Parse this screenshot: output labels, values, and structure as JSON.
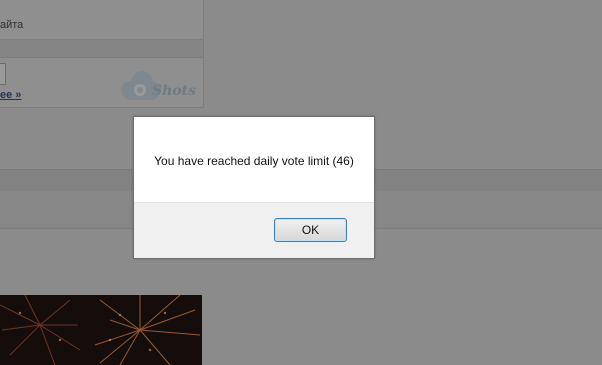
{
  "background": {
    "site_text": "айта",
    "more_link": "ее »",
    "logo_text": "Shots"
  },
  "dialog": {
    "message": "You have reached daily vote limit (46)",
    "ok_label": "OK"
  }
}
